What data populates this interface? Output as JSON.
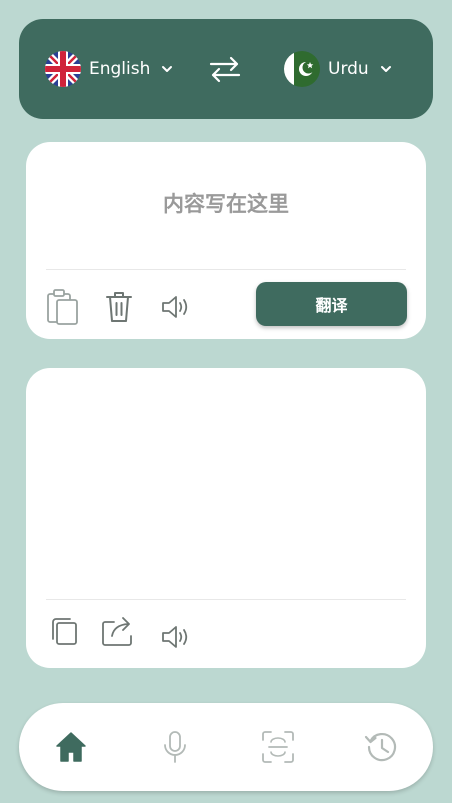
{
  "colors": {
    "background": "#bcd8d1",
    "primary": "#3f6b5f",
    "card": "#ffffff",
    "placeholder": "#9a9a9a",
    "icon_gray": "#9aa3a0"
  },
  "language_bar": {
    "source": {
      "flag_icon": "uk-flag-icon",
      "name": "English"
    },
    "swap_icon": "swap-arrows-icon",
    "target": {
      "flag_icon": "pakistan-flag-icon",
      "name": "Urdu"
    }
  },
  "input_card": {
    "placeholder": "内容写在这里",
    "tools": [
      "paste-icon",
      "trash-icon",
      "speaker-icon"
    ],
    "translate_label": "翻译"
  },
  "output_card": {
    "tools": [
      "copy-icon",
      "share-icon",
      "speaker-icon"
    ]
  },
  "bottom_nav": {
    "items": [
      "home-icon",
      "microphone-icon",
      "scan-icon",
      "history-icon"
    ],
    "active": "home-icon"
  }
}
